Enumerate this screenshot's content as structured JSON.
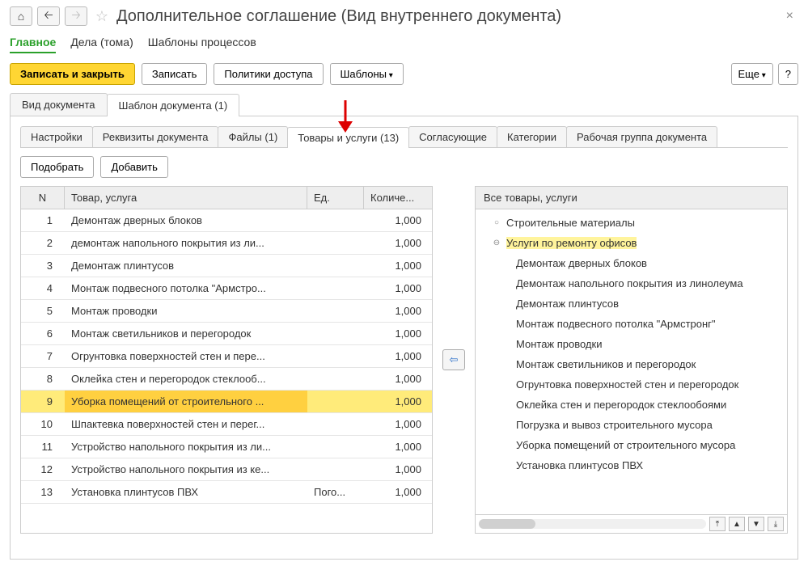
{
  "title": "Дополнительное соглашение (Вид внутреннего документа)",
  "main_tabs": {
    "main": "Главное",
    "cases": "Дела (тома)",
    "templates": "Шаблоны процессов"
  },
  "toolbar": {
    "save_close": "Записать и закрыть",
    "save": "Записать",
    "access_policies": "Политики доступа",
    "templates": "Шаблоны",
    "more": "Еще",
    "help": "?"
  },
  "page_tabs": {
    "doc_type": "Вид документа",
    "doc_template": "Шаблон документа (1)"
  },
  "inner_tabs": {
    "settings": "Настройки",
    "props": "Реквизиты документа",
    "files": "Файлы (1)",
    "goods": "Товары и услуги (13)",
    "approvers": "Согласующие",
    "categories": "Категории",
    "workgroup": "Рабочая группа документа"
  },
  "sub_toolbar": {
    "pick": "Подобрать",
    "add": "Добавить"
  },
  "table": {
    "headers": {
      "n": "N",
      "name": "Товар, услуга",
      "unit": "Ед.",
      "qty": "Количе..."
    },
    "rows": [
      {
        "n": "1",
        "name": "Демонтаж дверных блоков",
        "unit": "",
        "qty": "1,000"
      },
      {
        "n": "2",
        "name": "демонтаж напольного покрытия из ли...",
        "unit": "",
        "qty": "1,000"
      },
      {
        "n": "3",
        "name": "Демонтаж плинтусов",
        "unit": "",
        "qty": "1,000"
      },
      {
        "n": "4",
        "name": "Монтаж подвесного потолка \"Армстро...",
        "unit": "",
        "qty": "1,000"
      },
      {
        "n": "5",
        "name": "Монтаж проводки",
        "unit": "",
        "qty": "1,000"
      },
      {
        "n": "6",
        "name": "Монтаж светильников и перегородок",
        "unit": "",
        "qty": "1,000"
      },
      {
        "n": "7",
        "name": "Огрунтовка поверхностей стен и пере...",
        "unit": "",
        "qty": "1,000"
      },
      {
        "n": "8",
        "name": "Оклейка стен и перегородок стеклооб...",
        "unit": "",
        "qty": "1,000"
      },
      {
        "n": "9",
        "name": "Уборка помещений от строительного ...",
        "unit": "",
        "qty": "1,000"
      },
      {
        "n": "10",
        "name": "Шпактевка поверхностей стен и перег...",
        "unit": "",
        "qty": "1,000"
      },
      {
        "n": "11",
        "name": "Устройство напольного покрытия из ли...",
        "unit": "",
        "qty": "1,000"
      },
      {
        "n": "12",
        "name": "Устройство напольного покрытия из ке...",
        "unit": "",
        "qty": "1,000"
      },
      {
        "n": "13",
        "name": "Установка плинтусов ПВХ",
        "unit": "Пого...",
        "qty": "1,000"
      }
    ]
  },
  "tree": {
    "header": "Все товары, услуги",
    "groups": [
      {
        "label": "Строительные материалы",
        "expanded": false
      },
      {
        "label": "Услуги по ремонту офисов",
        "expanded": true,
        "highlighted": true
      }
    ],
    "items": [
      "Демонтаж дверных блоков",
      "Демонтаж напольного покрытия из линолеума",
      "Демонтаж плинтусов",
      "Монтаж подвесного потолка \"Армстронг\"",
      "Монтаж проводки",
      "Монтаж светильников и перегородок",
      "Огрунтовка поверхностей стен и перегородок",
      "Оклейка стен и перегородок стеклообоями",
      "Погрузка и вывоз строительного мусора",
      "Уборка помещений от строительного мусора",
      "Установка плинтусов ПВХ"
    ]
  }
}
